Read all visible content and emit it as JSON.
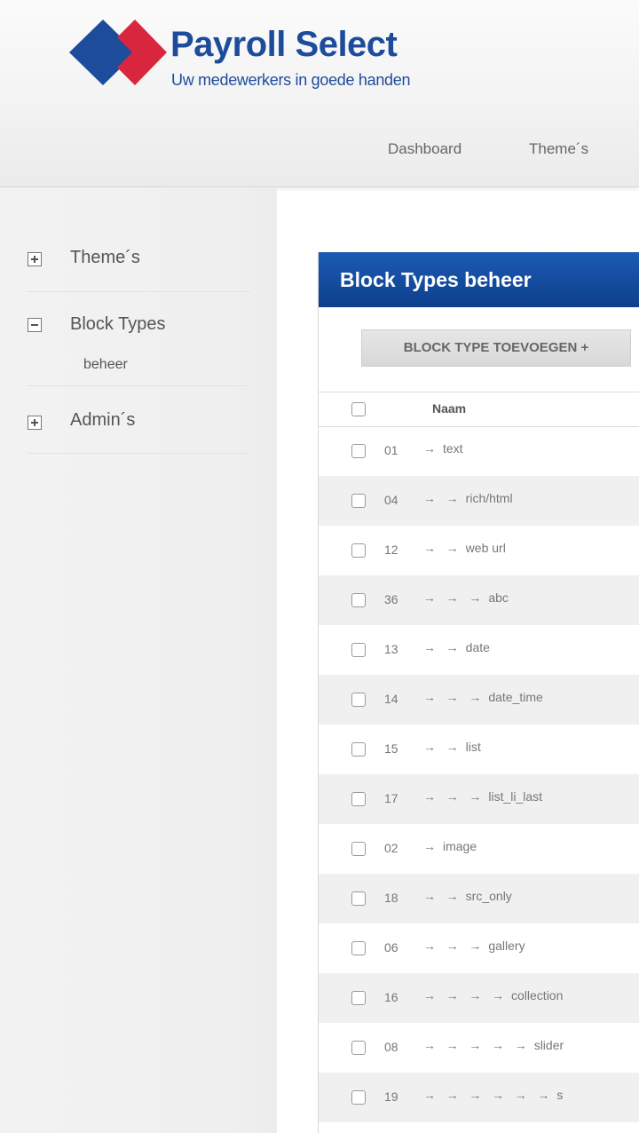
{
  "brand": {
    "name": "Payroll Select",
    "tagline": "Uw medewerkers in goede handen",
    "colors": {
      "blue": "#1d4c9c",
      "red": "#d7263d"
    }
  },
  "topnav": {
    "items": [
      "Dashboard",
      "Theme´s"
    ]
  },
  "sidebar": {
    "items": [
      {
        "label": "Theme´s",
        "state": "collapsed"
      },
      {
        "label": "Block Types",
        "state": "expanded",
        "subitems": [
          "beheer"
        ]
      },
      {
        "label": "Admin´s",
        "state": "collapsed"
      }
    ]
  },
  "panel": {
    "title": "Block Types beheer",
    "add_button": "BLOCK TYPE TOEVOEGEN",
    "add_button_icon": "+",
    "column_naam": "Naam"
  },
  "rows": [
    {
      "id": "01",
      "arrows": "→",
      "name": "text"
    },
    {
      "id": "04",
      "arrows": "→   →",
      "name": "rich/html"
    },
    {
      "id": "12",
      "arrows": "→   →",
      "name": "web url"
    },
    {
      "id": "36",
      "arrows": "→   →   →",
      "name": "abc"
    },
    {
      "id": "13",
      "arrows": "→   →",
      "name": "date"
    },
    {
      "id": "14",
      "arrows": "→   →   →",
      "name": "date_time"
    },
    {
      "id": "15",
      "arrows": "→   →",
      "name": "list"
    },
    {
      "id": "17",
      "arrows": "→   →   →",
      "name": "list_li_last"
    },
    {
      "id": "02",
      "arrows": "→",
      "name": "image"
    },
    {
      "id": "18",
      "arrows": "→   →",
      "name": "src_only"
    },
    {
      "id": "06",
      "arrows": "→   →   →",
      "name": "gallery"
    },
    {
      "id": "16",
      "arrows": "→   →   →   →",
      "name": "collection"
    },
    {
      "id": "08",
      "arrows": "→   →   →   →   →",
      "name": "slider"
    },
    {
      "id": "19",
      "arrows": "→   →   →   →   →   →",
      "name": "s"
    }
  ]
}
